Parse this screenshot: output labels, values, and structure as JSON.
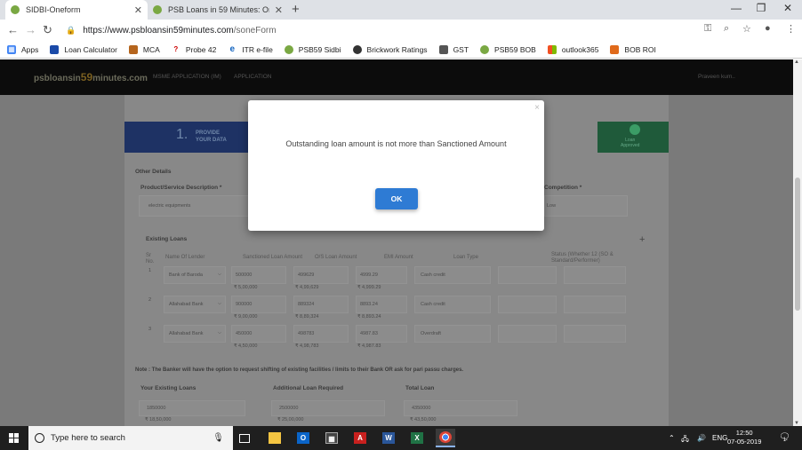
{
  "browser": {
    "tabs": [
      {
        "title": "SIDBI-Oneform",
        "active": true
      },
      {
        "title": "PSB Loans in 59 Minutes: Online",
        "active": false
      }
    ],
    "url_host": "https://www.psbloansin59minutes.com",
    "url_path": "/soneForm",
    "bookmarks": [
      "Apps",
      "Loan Calculator",
      "MCA",
      "Probe 42",
      "ITR e-file",
      "PSB59 Sidbi",
      "Brickwork Ratings",
      "GST",
      "PSB59 BOB",
      "outlook365",
      "BOB ROI"
    ]
  },
  "site": {
    "logo_prefix": "psbloansin",
    "logo_59": "59",
    "logo_suffix": "minutes.com",
    "nav": [
      "MSME APPLICATION (IM)",
      "APPLICATION"
    ],
    "user": "Praveen kum..",
    "steps": {
      "first_number": "1.",
      "first_label_1": "PROVIDE",
      "first_label_2": "YOUR DATA",
      "last_label_1": "Loan",
      "last_label_2": "Approved"
    },
    "other_details": "Other Details",
    "product_label": "Product/Service Description *",
    "product_value": "electric equipments",
    "competition_label": "Competition *",
    "competition_value": "Low",
    "existing_loans": "Existing Loans",
    "loan_headers": [
      "Sr No.",
      "Name Of Lender",
      "Sanctioned Loan Amount",
      "O/S Loan Amount",
      "EMI Amount",
      "Loan Type",
      "Status (Whether 12 (SO & Standard/Performer)"
    ],
    "loans": [
      {
        "sr": "1",
        "lender": "Bank of Baroda",
        "sanctioned": "500000",
        "sanctioned_fmt": "₹ 5,00,000",
        "os": "499629",
        "os_fmt": "₹ 4,99,629",
        "emi": "4999.29",
        "emi_fmt": "₹ 4,999.29",
        "type": "Cash credit"
      },
      {
        "sr": "2",
        "lender": "Allahabad Bank",
        "sanctioned": "900000",
        "sanctioned_fmt": "₹ 9,00,000",
        "os": "889324",
        "os_fmt": "₹ 8,89,324",
        "emi": "8893.24",
        "emi_fmt": "₹ 8,893.24",
        "type": "Cash credit"
      },
      {
        "sr": "3",
        "lender": "Allahabad Bank",
        "sanctioned": "450000",
        "sanctioned_fmt": "₹ 4,50,000",
        "os": "498783",
        "os_fmt": "₹ 4,98,783",
        "emi": "4987.83",
        "emi_fmt": "₹ 4,987.83",
        "type": "Overdraft"
      }
    ],
    "note": "Note : The Banker will have the option to request shifting of existing facilities / limits to their Bank OR ask for pari passu charges.",
    "your_existing_loans_label": "Your Existing Loans",
    "your_existing_loans_value": "1850000",
    "your_existing_loans_fmt": "₹ 18,50,000",
    "additional_loan_label": "Additional Loan Required",
    "additional_loan_value": "2500000",
    "additional_loan_fmt": "₹ 25,00,000",
    "total_loan_label": "Total Loan",
    "total_loan_value": "4350000",
    "total_loan_fmt": "₹ 43,50,000"
  },
  "modal": {
    "message": "Outstanding loan amount is not more than Sanctioned Amount",
    "ok_label": "OK",
    "close_glyph": "×"
  },
  "taskbar": {
    "search_placeholder": "Type here to search",
    "language": "ENG",
    "time": "12:50",
    "date": "07-05-2019",
    "notification_count": "1"
  },
  "colors": {
    "ok_button": "#2e7bd4",
    "overlay": "#7a7a7a",
    "taskbar": "#1f1f1f"
  }
}
